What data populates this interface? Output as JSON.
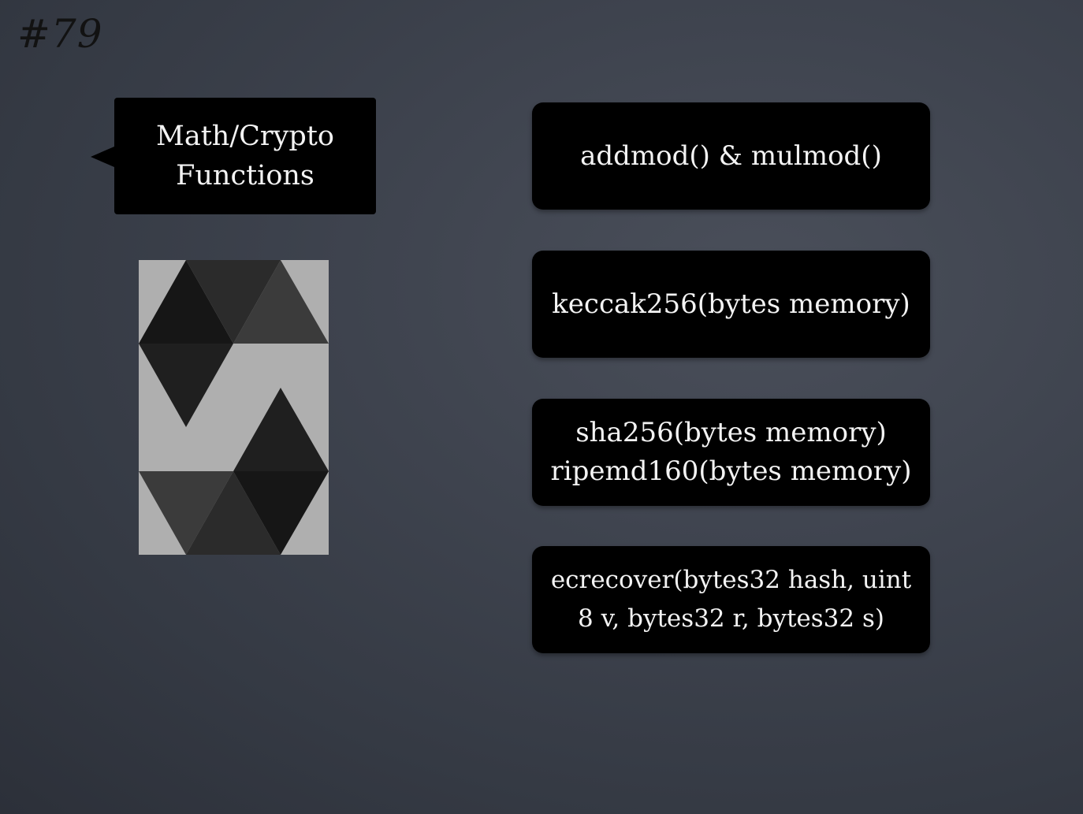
{
  "slide": {
    "number_label": "#79"
  },
  "callout": {
    "line1": "Math/Crypto",
    "line2": "Functions"
  },
  "logo": {
    "icon": "solidity-logo-icon"
  },
  "functions": [
    {
      "line1": "addmod() & mulmod()"
    },
    {
      "line1": "keccak256(bytes memory)"
    },
    {
      "line1": "sha256(bytes memory)",
      "line2": "ripemd160(bytes memory)"
    },
    {
      "line1": "ecrecover(bytes32 hash, uint",
      "line2": "8 v, bytes32 r, bytes32 s)"
    }
  ],
  "colors": {
    "background": "#3a3f4a",
    "box": "#000000",
    "text": "#f3f3f3",
    "logo_bg": "#afafaf"
  }
}
